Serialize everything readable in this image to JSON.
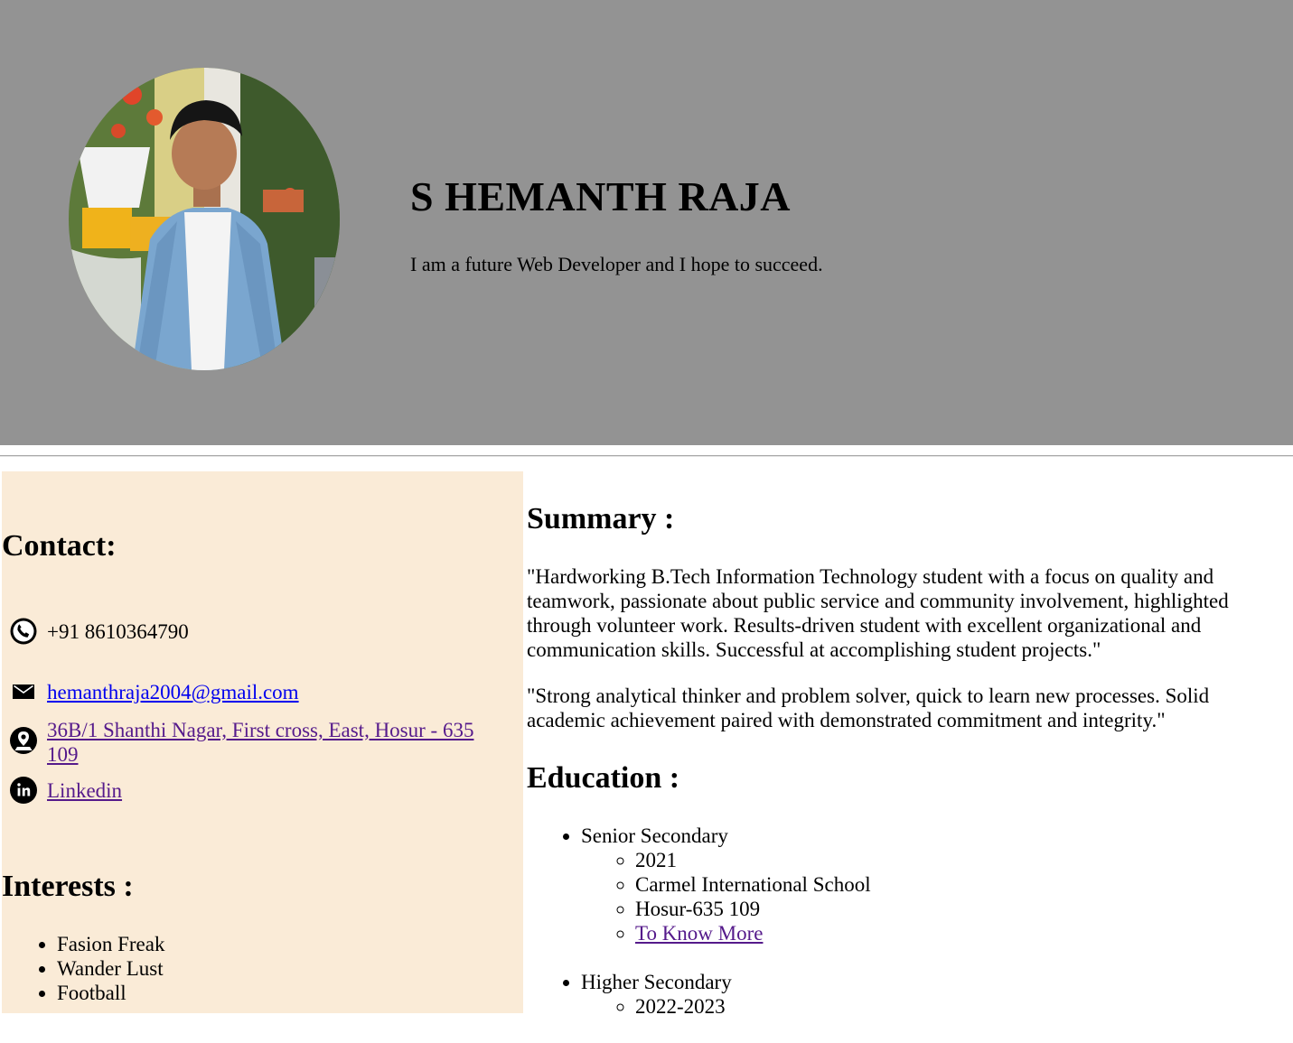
{
  "profile": {
    "name": "S HEMANTH RAJA",
    "tagline": "I am a future Web Developer and I hope to succeed.",
    "photo_icon": "profile-photo"
  },
  "contact": {
    "heading": "Contact:",
    "phone": "+91 8610364790",
    "email": "hemanthraja2004@gmail.com",
    "address": "36B/1 Shanthi Nagar, First cross, East, Hosur - 635 109",
    "linkedin": "Linkedin",
    "icons": [
      "phone-icon",
      "mail-icon",
      "location-icon",
      "linkedin-icon"
    ]
  },
  "interests": {
    "heading": "Interests :",
    "items": [
      "Fasion Freak",
      "Wander Lust",
      "Football"
    ]
  },
  "summary": {
    "heading": "Summary :",
    "paragraphs": [
      "\"Hardworking B.Tech Information Technology student with a focus on quality and teamwork, passionate about public service and community involvement, highlighted through volunteer work. Results-driven student with excellent organizational and communication skills. Successful at accomplishing student projects.\"",
      "\"Strong analytical thinker and problem solver, quick to learn new processes. Solid academic achievement paired with demonstrated commitment and integrity.\""
    ]
  },
  "education": {
    "heading": "Education :",
    "entries": [
      {
        "title": "Senior Secondary",
        "details": [
          "2021",
          "Carmel International School",
          "Hosur-635 109"
        ],
        "link": "To Know More"
      },
      {
        "title": "Higher Secondary",
        "details": [
          "2022-2023"
        ]
      }
    ]
  },
  "colors": {
    "header_bg": "#939393",
    "sidebar_bg": "#faebd7",
    "link": "#0000ee",
    "visited_link": "#551a8b"
  }
}
